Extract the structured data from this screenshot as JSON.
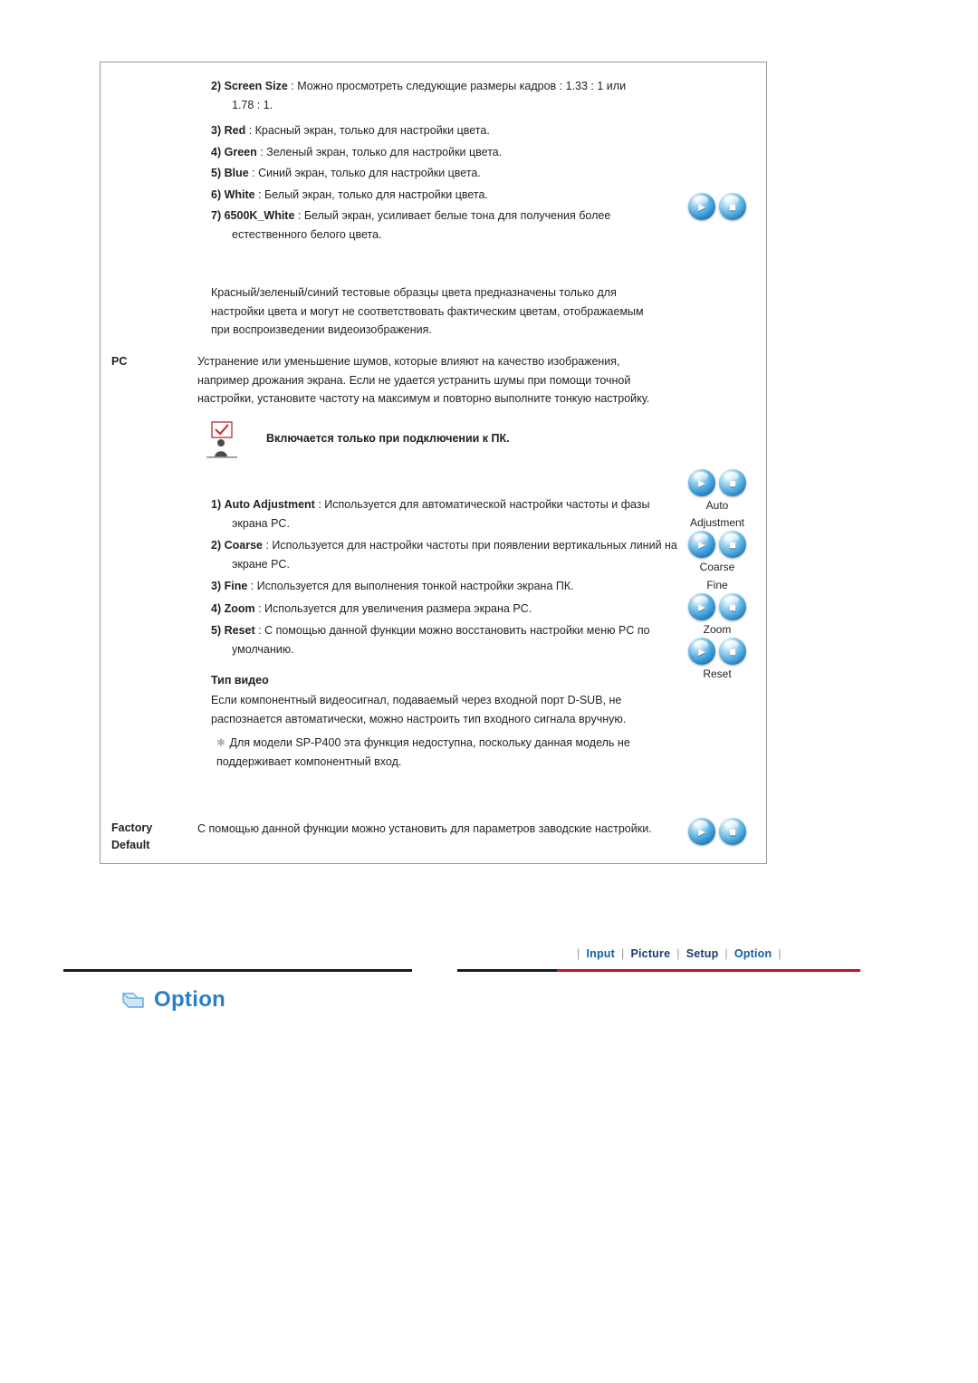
{
  "document": {
    "content": {
      "items": [
        {
          "num": "2)",
          "term": "Screen Size",
          "text": " : Можно просмотреть следующие размеры кадров : 1.33 : 1 или 1.78 : 1."
        },
        {
          "num": "3)",
          "term": "Red",
          "text": " : Красный экран, только для настройки цвета."
        },
        {
          "num": "4)",
          "term": "Green",
          "text": " : Зеленый экран, только для настройки цвета."
        },
        {
          "num": "5)",
          "term": "Blue",
          "text": " : Синий экран, только для настройки цвета."
        },
        {
          "num": "6)",
          "term": "White",
          "text": " : Белый экран, только для настройки цвета."
        },
        {
          "num": "7)",
          "term": "6500K_White",
          "text": " : Белый экран, усиливает белые тона для получения более естественного белого цвета."
        }
      ],
      "note_paragraph": "Красный/зеленый/синий тестовые образцы цвета предназначены только для настройки цвета и могут не соответствовать фактическим цветам, отображаемым при воспроизведении видеоизображения.",
      "pc_label": "PC",
      "pc_paragraph": "Устранение или уменьшение шумов, которые влияют на качество изображения, например дрожания экрана. Если не удается устранить шумы при помощи точной настройки, установите частоту на максимум и повторно выполните тонкую настройку.",
      "note_box_title": "Включается только при подключении к ПК.",
      "pc_items": [
        {
          "num": "1)",
          "term": "Auto Adjustment",
          "text": " : Используется для автоматической настройки частоты и фазы экрана PC."
        },
        {
          "num": "2)",
          "term": "Coarse",
          "text": " : Используется для настройки частоты при появлении вертикальных линий на экране PC."
        },
        {
          "num": "3)",
          "term": "Fine",
          "text": " : Используется для выполнения тонкой настройки экрана ПК."
        },
        {
          "num": "4)",
          "term": "Zoom",
          "text": " : Используется для увеличения размера экрана PC."
        },
        {
          "num": "5)",
          "term": "Reset",
          "text": " : С помощью данной функции можно восстановить настройки меню PC по умолчанию."
        }
      ],
      "video_type_title": "Тип видео",
      "video_type_paragraph": "Если компонентный видеосигнал, подаваемый через входной порт D-SUB, не распознается автоматически, можно настроить тип входного сигнала вручную.",
      "video_type_note": "Для модели SP-P400 эта функция недоступна, поскольку данная модель не поддерживает компонентный вход.",
      "factory_label_line1": "Factory",
      "factory_label_line2": "Default",
      "factory_paragraph": "С помощью данной функции можно установить для параметров заводские настройки."
    },
    "button_captions": [
      {
        "line1": "Auto",
        "line2": "Adjustment"
      },
      {
        "line1": "Coarse",
        "line2": ""
      },
      {
        "line1": "Fine",
        "line2": ""
      },
      {
        "line1": "Zoom",
        "line2": ""
      },
      {
        "line1": "Reset",
        "line2": ""
      }
    ],
    "footer_nav": {
      "sep": "|",
      "items": [
        "Input",
        "Picture",
        "Setup",
        "Option"
      ]
    },
    "section_heading": "Option",
    "colors": {
      "accent_blue": "#2b7ec1",
      "link_blue": "#0f5fa6",
      "rule_red": "#c3122a",
      "text": "#231f20"
    }
  }
}
